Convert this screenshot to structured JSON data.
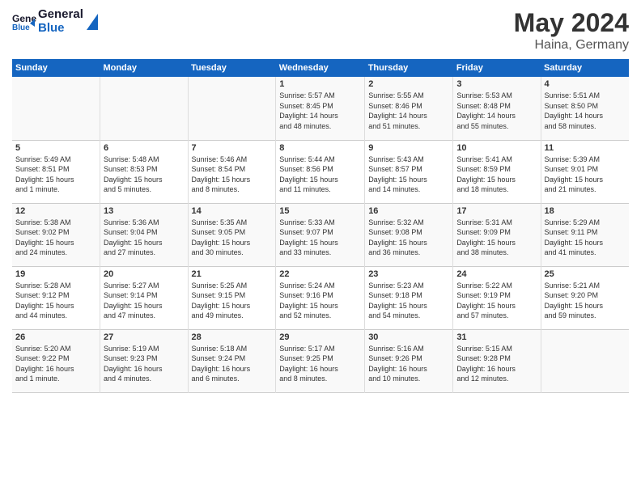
{
  "header": {
    "logo_general": "General",
    "logo_blue": "Blue",
    "month_title": "May 2024",
    "location": "Haina, Germany"
  },
  "days_of_week": [
    "Sunday",
    "Monday",
    "Tuesday",
    "Wednesday",
    "Thursday",
    "Friday",
    "Saturday"
  ],
  "weeks": [
    [
      {
        "day": "",
        "info": ""
      },
      {
        "day": "",
        "info": ""
      },
      {
        "day": "",
        "info": ""
      },
      {
        "day": "1",
        "info": "Sunrise: 5:57 AM\nSunset: 8:45 PM\nDaylight: 14 hours\nand 48 minutes."
      },
      {
        "day": "2",
        "info": "Sunrise: 5:55 AM\nSunset: 8:46 PM\nDaylight: 14 hours\nand 51 minutes."
      },
      {
        "day": "3",
        "info": "Sunrise: 5:53 AM\nSunset: 8:48 PM\nDaylight: 14 hours\nand 55 minutes."
      },
      {
        "day": "4",
        "info": "Sunrise: 5:51 AM\nSunset: 8:50 PM\nDaylight: 14 hours\nand 58 minutes."
      }
    ],
    [
      {
        "day": "5",
        "info": "Sunrise: 5:49 AM\nSunset: 8:51 PM\nDaylight: 15 hours\nand 1 minute."
      },
      {
        "day": "6",
        "info": "Sunrise: 5:48 AM\nSunset: 8:53 PM\nDaylight: 15 hours\nand 5 minutes."
      },
      {
        "day": "7",
        "info": "Sunrise: 5:46 AM\nSunset: 8:54 PM\nDaylight: 15 hours\nand 8 minutes."
      },
      {
        "day": "8",
        "info": "Sunrise: 5:44 AM\nSunset: 8:56 PM\nDaylight: 15 hours\nand 11 minutes."
      },
      {
        "day": "9",
        "info": "Sunrise: 5:43 AM\nSunset: 8:57 PM\nDaylight: 15 hours\nand 14 minutes."
      },
      {
        "day": "10",
        "info": "Sunrise: 5:41 AM\nSunset: 8:59 PM\nDaylight: 15 hours\nand 18 minutes."
      },
      {
        "day": "11",
        "info": "Sunrise: 5:39 AM\nSunset: 9:01 PM\nDaylight: 15 hours\nand 21 minutes."
      }
    ],
    [
      {
        "day": "12",
        "info": "Sunrise: 5:38 AM\nSunset: 9:02 PM\nDaylight: 15 hours\nand 24 minutes."
      },
      {
        "day": "13",
        "info": "Sunrise: 5:36 AM\nSunset: 9:04 PM\nDaylight: 15 hours\nand 27 minutes."
      },
      {
        "day": "14",
        "info": "Sunrise: 5:35 AM\nSunset: 9:05 PM\nDaylight: 15 hours\nand 30 minutes."
      },
      {
        "day": "15",
        "info": "Sunrise: 5:33 AM\nSunset: 9:07 PM\nDaylight: 15 hours\nand 33 minutes."
      },
      {
        "day": "16",
        "info": "Sunrise: 5:32 AM\nSunset: 9:08 PM\nDaylight: 15 hours\nand 36 minutes."
      },
      {
        "day": "17",
        "info": "Sunrise: 5:31 AM\nSunset: 9:09 PM\nDaylight: 15 hours\nand 38 minutes."
      },
      {
        "day": "18",
        "info": "Sunrise: 5:29 AM\nSunset: 9:11 PM\nDaylight: 15 hours\nand 41 minutes."
      }
    ],
    [
      {
        "day": "19",
        "info": "Sunrise: 5:28 AM\nSunset: 9:12 PM\nDaylight: 15 hours\nand 44 minutes."
      },
      {
        "day": "20",
        "info": "Sunrise: 5:27 AM\nSunset: 9:14 PM\nDaylight: 15 hours\nand 47 minutes."
      },
      {
        "day": "21",
        "info": "Sunrise: 5:25 AM\nSunset: 9:15 PM\nDaylight: 15 hours\nand 49 minutes."
      },
      {
        "day": "22",
        "info": "Sunrise: 5:24 AM\nSunset: 9:16 PM\nDaylight: 15 hours\nand 52 minutes."
      },
      {
        "day": "23",
        "info": "Sunrise: 5:23 AM\nSunset: 9:18 PM\nDaylight: 15 hours\nand 54 minutes."
      },
      {
        "day": "24",
        "info": "Sunrise: 5:22 AM\nSunset: 9:19 PM\nDaylight: 15 hours\nand 57 minutes."
      },
      {
        "day": "25",
        "info": "Sunrise: 5:21 AM\nSunset: 9:20 PM\nDaylight: 15 hours\nand 59 minutes."
      }
    ],
    [
      {
        "day": "26",
        "info": "Sunrise: 5:20 AM\nSunset: 9:22 PM\nDaylight: 16 hours\nand 1 minute."
      },
      {
        "day": "27",
        "info": "Sunrise: 5:19 AM\nSunset: 9:23 PM\nDaylight: 16 hours\nand 4 minutes."
      },
      {
        "day": "28",
        "info": "Sunrise: 5:18 AM\nSunset: 9:24 PM\nDaylight: 16 hours\nand 6 minutes."
      },
      {
        "day": "29",
        "info": "Sunrise: 5:17 AM\nSunset: 9:25 PM\nDaylight: 16 hours\nand 8 minutes."
      },
      {
        "day": "30",
        "info": "Sunrise: 5:16 AM\nSunset: 9:26 PM\nDaylight: 16 hours\nand 10 minutes."
      },
      {
        "day": "31",
        "info": "Sunrise: 5:15 AM\nSunset: 9:28 PM\nDaylight: 16 hours\nand 12 minutes."
      },
      {
        "day": "",
        "info": ""
      }
    ]
  ]
}
